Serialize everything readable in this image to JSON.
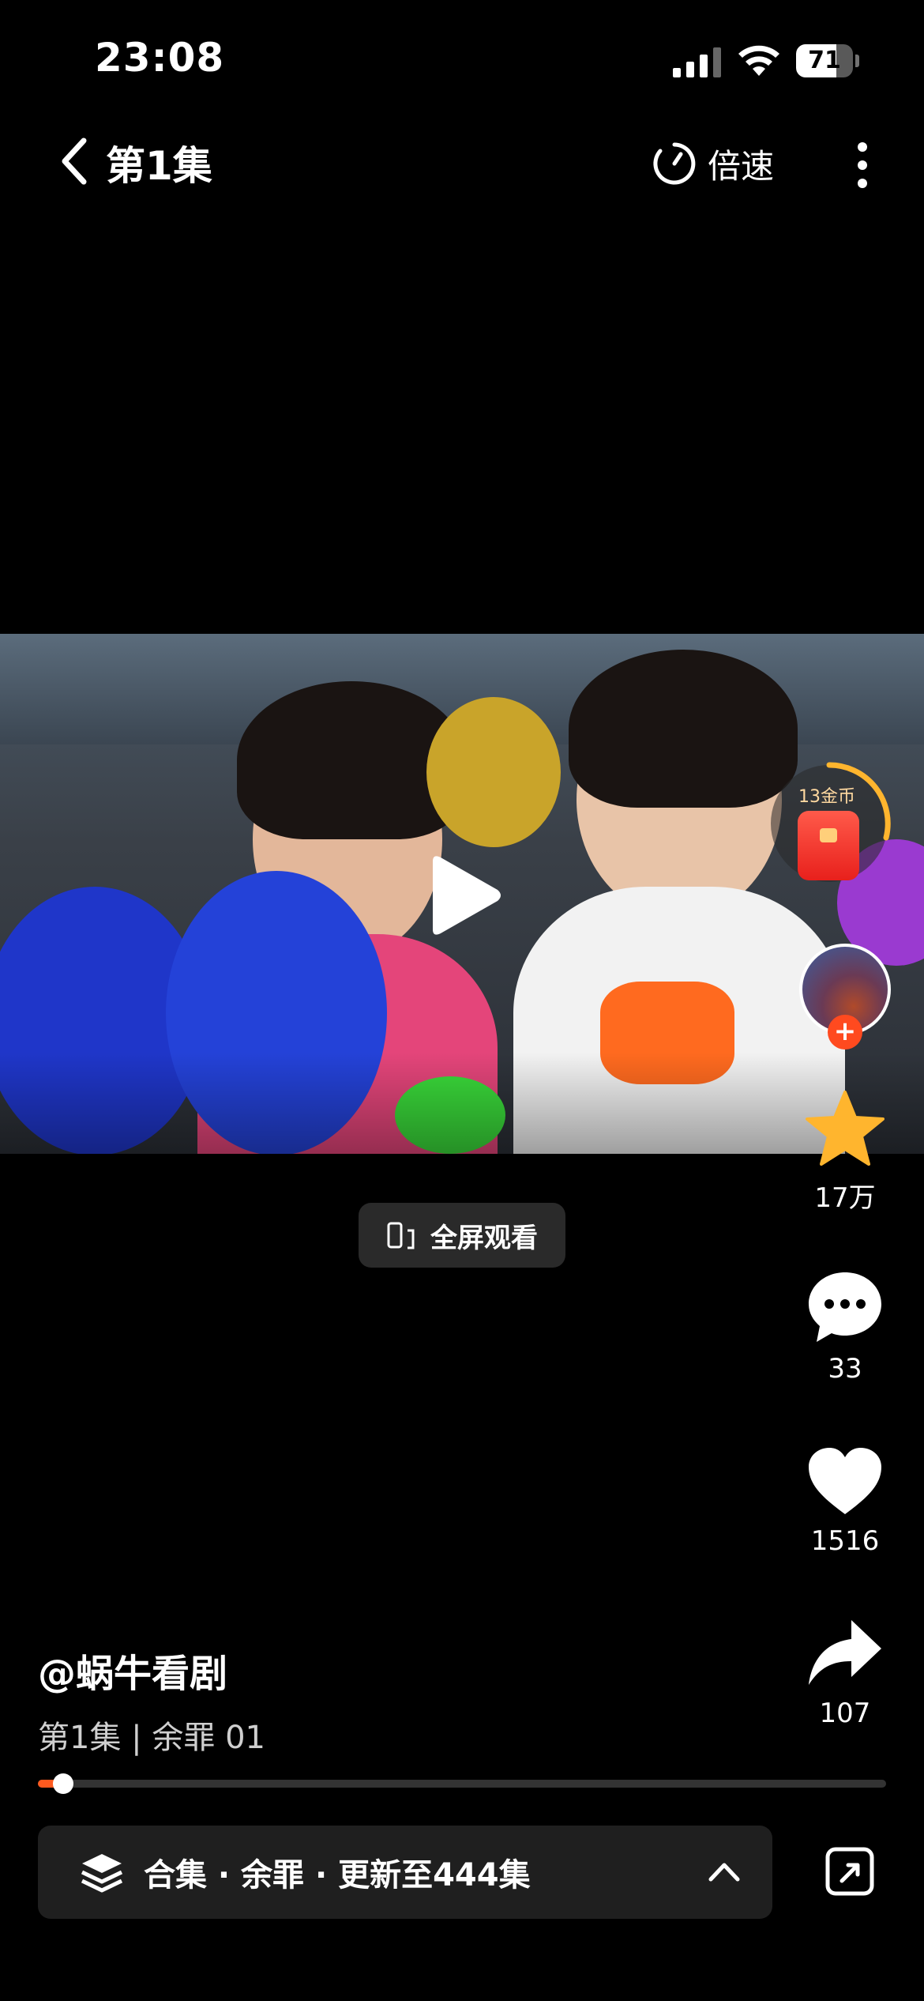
{
  "status_bar": {
    "time": "23:08",
    "battery_percent": "71",
    "battery_level": 0.71
  },
  "nav": {
    "title": "第1集",
    "speed_label": "倍速"
  },
  "video": {
    "paused": true
  },
  "reward": {
    "coin_label": "13金币"
  },
  "actions": {
    "favorite_count": "17万",
    "comment_count": "33",
    "like_count": "1516",
    "share_count": "107"
  },
  "fullscreen_label": "全屏观看",
  "author": "@蜗牛看剧",
  "episode_info": "第1集 | 余罪 01",
  "progress": {
    "fraction": 0.03
  },
  "collection": {
    "label": "合集 · 余罪 · 更新至444集"
  },
  "colors": {
    "accent": "#ff5a1f",
    "favorite": "#ffb52e",
    "background": "#000000"
  }
}
